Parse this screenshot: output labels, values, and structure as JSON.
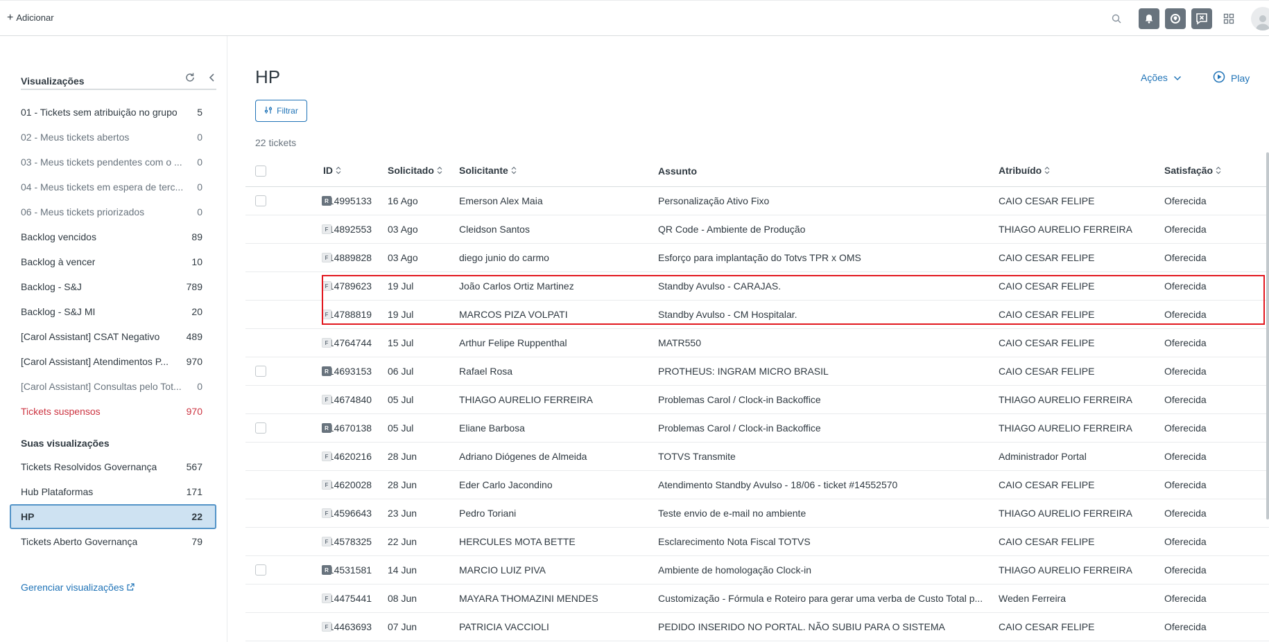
{
  "topbar": {
    "add_label": "Adicionar"
  },
  "sidebar": {
    "title": "Visualizações",
    "items": [
      {
        "label": "01 - Tickets sem atribuição no grupo",
        "count": "5",
        "style": "normal"
      },
      {
        "label": "02 - Meus tickets abertos",
        "count": "0",
        "style": "muted"
      },
      {
        "label": "03 - Meus tickets pendentes com o ...",
        "count": "0",
        "style": "muted"
      },
      {
        "label": "04 - Meus tickets em espera de terc...",
        "count": "0",
        "style": "muted"
      },
      {
        "label": "06 - Meus tickets priorizados",
        "count": "0",
        "style": "muted"
      },
      {
        "label": "Backlog vencidos",
        "count": "89",
        "style": "normal"
      },
      {
        "label": "Backlog à vencer",
        "count": "10",
        "style": "normal"
      },
      {
        "label": "Backlog - S&J",
        "count": "789",
        "style": "normal"
      },
      {
        "label": "Backlog - S&J MI",
        "count": "20",
        "style": "normal"
      },
      {
        "label": "[Carol Assistant] CSAT Negativo",
        "count": "489",
        "style": "normal"
      },
      {
        "label": "[Carol Assistant] Atendimentos P...",
        "count": "970",
        "style": "normal"
      },
      {
        "label": "[Carol Assistant] Consultas pelo Tot...",
        "count": "0",
        "style": "muted"
      },
      {
        "label": "Tickets suspensos",
        "count": "970",
        "style": "danger"
      }
    ],
    "your_views_title": "Suas visualizações",
    "your_views": [
      {
        "label": "Tickets Resolvidos Governança",
        "count": "567"
      },
      {
        "label": "Hub Plataformas",
        "count": "171"
      },
      {
        "label": "HP",
        "count": "22",
        "active": true
      },
      {
        "label": "Tickets Aberto Governança",
        "count": "79"
      }
    ],
    "manage_label": "Gerenciar visualizações"
  },
  "main": {
    "title": "HP",
    "actions_label": "Ações",
    "play_label": "Play",
    "filter_label": "Filtrar",
    "count_label": "22 tickets",
    "columns": [
      "ID",
      "Solicitado",
      "Solicitante",
      "Assunto",
      "Atribuído",
      "Satisfação"
    ],
    "rows": [
      {
        "checkbox": true,
        "badge": "R",
        "id": "#14995133",
        "date": "16 Ago",
        "requester": "Emerson Alex Maia",
        "subject": "Personalização Ativo Fixo",
        "assignee": "CAIO CESAR FELIPE",
        "satisfaction": "Oferecida"
      },
      {
        "checkbox": false,
        "badge": "F",
        "id": "#14892553",
        "date": "03 Ago",
        "requester": "Cleidson Santos",
        "subject": "QR Code - Ambiente de Produção",
        "assignee": "THIAGO AURELIO FERREIRA",
        "satisfaction": "Oferecida"
      },
      {
        "checkbox": false,
        "badge": "F",
        "id": "#14889828",
        "date": "03 Ago",
        "requester": "diego junio do carmo",
        "subject": "Esforço para implantação do Totvs TPR x OMS",
        "assignee": "CAIO CESAR FELIPE",
        "satisfaction": "Oferecida"
      },
      {
        "checkbox": false,
        "badge": "F",
        "id": "#14789623",
        "date": "19 Jul",
        "requester": "João Carlos Ortiz Martinez",
        "subject": "Standby Avulso - CARAJAS.",
        "assignee": "CAIO CESAR FELIPE",
        "satisfaction": "Oferecida"
      },
      {
        "checkbox": false,
        "badge": "F",
        "id": "#14788819",
        "date": "19 Jul",
        "requester": "MARCOS PIZA VOLPATI",
        "subject": "Standby Avulso - CM Hospitalar.",
        "assignee": "CAIO CESAR FELIPE",
        "satisfaction": "Oferecida"
      },
      {
        "checkbox": false,
        "badge": "F",
        "id": "#14764744",
        "date": "15 Jul",
        "requester": "Arthur Felipe Ruppenthal",
        "subject": "MATR550",
        "assignee": "CAIO CESAR FELIPE",
        "satisfaction": "Oferecida"
      },
      {
        "checkbox": true,
        "badge": "R",
        "id": "#14693153",
        "date": "06 Jul",
        "requester": "Rafael Rosa",
        "subject": "PROTHEUS: INGRAM MICRO BRASIL",
        "assignee": "CAIO CESAR FELIPE",
        "satisfaction": "Oferecida"
      },
      {
        "checkbox": false,
        "badge": "F",
        "id": "#14674840",
        "date": "05 Jul",
        "requester": "THIAGO AURELIO FERREIRA",
        "subject": "Problemas Carol / Clock-in Backoffice",
        "assignee": "THIAGO AURELIO FERREIRA",
        "satisfaction": "Oferecida"
      },
      {
        "checkbox": true,
        "badge": "R",
        "id": "#14670138",
        "date": "05 Jul",
        "requester": "Eliane Barbosa",
        "subject": "Problemas Carol / Clock-in Backoffice",
        "assignee": "THIAGO AURELIO FERREIRA",
        "satisfaction": "Oferecida"
      },
      {
        "checkbox": false,
        "badge": "F",
        "id": "#14620216",
        "date": "28 Jun",
        "requester": "Adriano Diógenes de Almeida",
        "subject": "TOTVS Transmite",
        "assignee": "Administrador Portal",
        "satisfaction": "Oferecida"
      },
      {
        "checkbox": false,
        "badge": "F",
        "id": "#14620028",
        "date": "28 Jun",
        "requester": "Eder Carlo Jacondino",
        "subject": "Atendimento Standby Avulso - 18/06 - ticket #14552570",
        "assignee": "CAIO CESAR FELIPE",
        "satisfaction": "Oferecida"
      },
      {
        "checkbox": false,
        "badge": "F",
        "id": "#14596643",
        "date": "23 Jun",
        "requester": "Pedro Toriani",
        "subject": "Teste envio de e-mail no ambiente",
        "assignee": "THIAGO AURELIO FERREIRA",
        "satisfaction": "Oferecida"
      },
      {
        "checkbox": false,
        "badge": "F",
        "id": "#14578325",
        "date": "22 Jun",
        "requester": "HERCULES MOTA BETTE",
        "subject": "Esclarecimento Nota Fiscal TOTVS",
        "assignee": "CAIO CESAR FELIPE",
        "satisfaction": "Oferecida"
      },
      {
        "checkbox": true,
        "badge": "R",
        "id": "#14531581",
        "date": "14 Jun",
        "requester": "MARCIO LUIZ PIVA",
        "subject": "Ambiente de homologação Clock-in",
        "assignee": "THIAGO AURELIO FERREIRA",
        "satisfaction": "Oferecida"
      },
      {
        "checkbox": false,
        "badge": "F",
        "id": "#14475441",
        "date": "08 Jun",
        "requester": "MAYARA THOMAZINI MENDES",
        "subject": "Customização - Fórmula e Roteiro para gerar uma verba de Custo Total p...",
        "assignee": "Weden Ferreira",
        "satisfaction": "Oferecida"
      },
      {
        "checkbox": false,
        "badge": "F",
        "id": "#14463693",
        "date": "07 Jun",
        "requester": "PATRICIA VACCIOLI",
        "subject": "PEDIDO INSERIDO NO PORTAL. NÃO SUBIU PARA O SISTEMA",
        "assignee": "CAIO CESAR FELIPE",
        "satisfaction": "Oferecida"
      }
    ]
  },
  "colors": {
    "accent": "#1f73b7",
    "danger": "#cc3340",
    "highlight_box": "#e2171e",
    "active_bg": "#cee2f2"
  }
}
